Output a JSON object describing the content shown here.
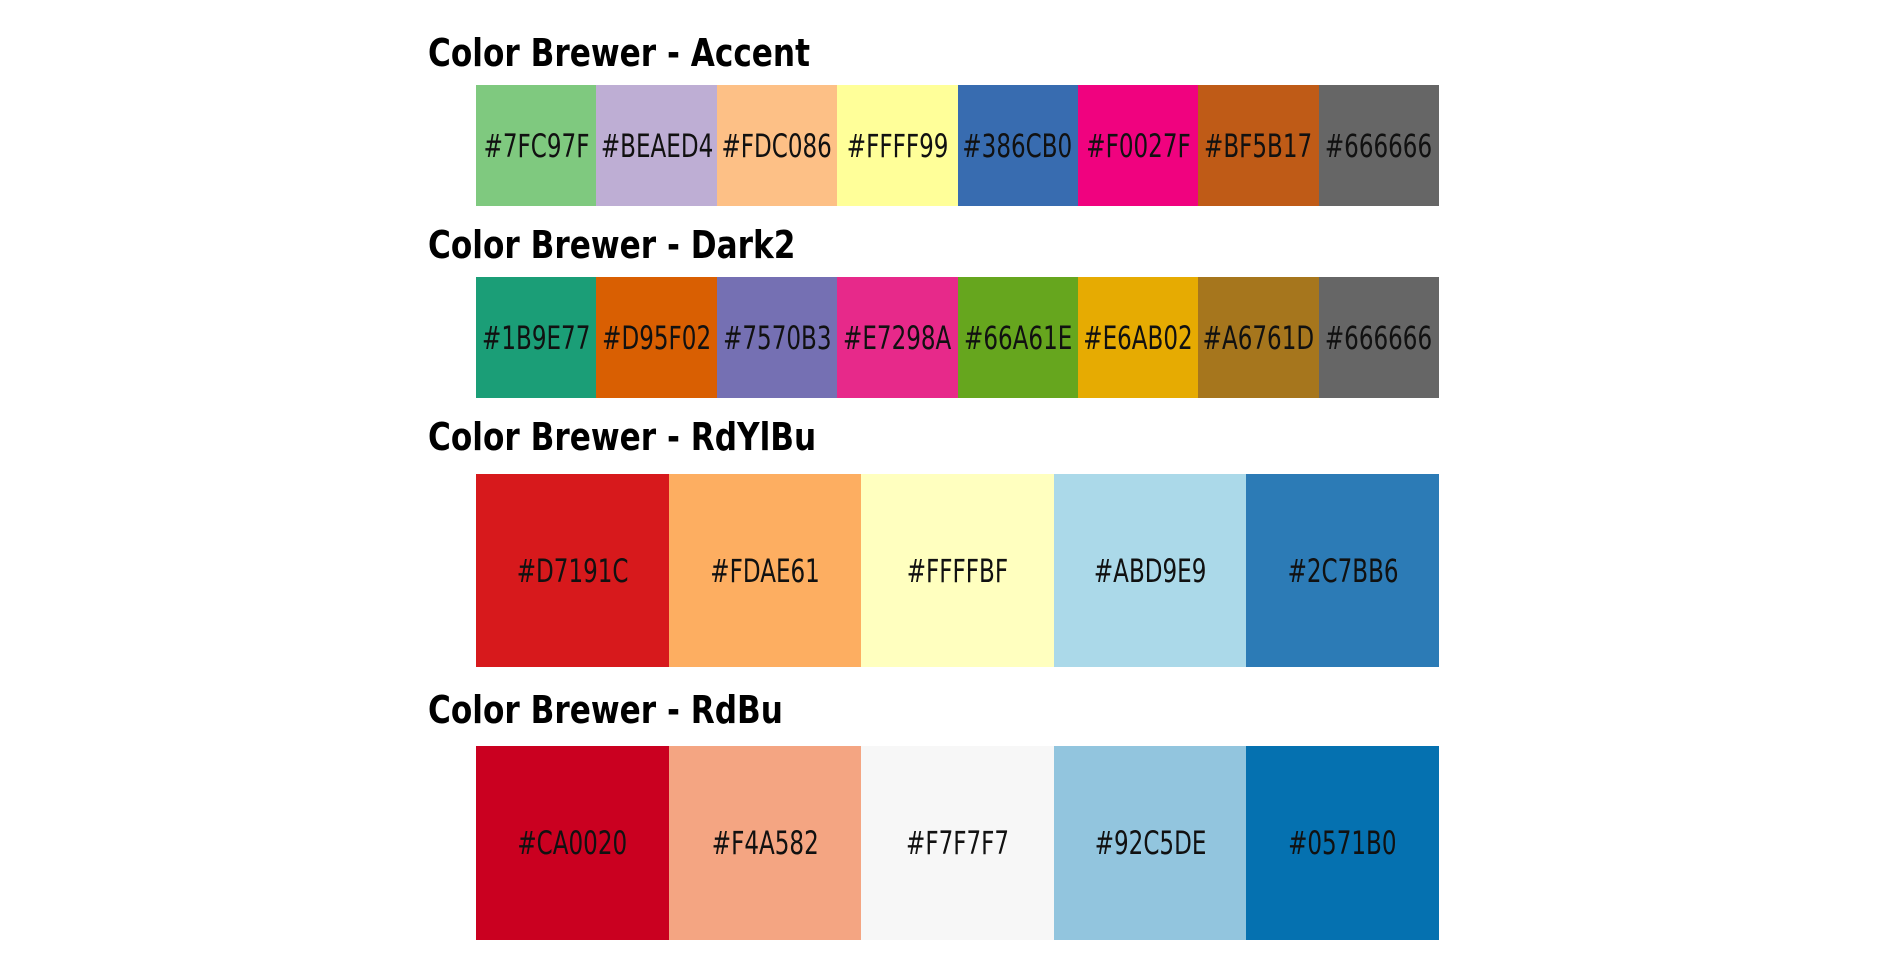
{
  "palettes": [
    {
      "title": "Color Brewer - Accent",
      "colors": [
        "#7FC97F",
        "#BEAED4",
        "#FDC086",
        "#FFFF99",
        "#386CB0",
        "#F0027F",
        "#BF5B17",
        "#666666"
      ]
    },
    {
      "title": "Color Brewer - Dark2",
      "colors": [
        "#1B9E77",
        "#D95F02",
        "#7570B3",
        "#E7298A",
        "#66A61E",
        "#E6AB02",
        "#A6761D",
        "#666666"
      ]
    },
    {
      "title": "Color Brewer - RdYlBu",
      "colors": [
        "#D7191C",
        "#FDAE61",
        "#FFFFBF",
        "#ABD9E9",
        "#2C7BB6"
      ]
    },
    {
      "title": "Color Brewer - RdBu",
      "colors": [
        "#CA0020",
        "#F4A582",
        "#F7F7F7",
        "#92C5DE",
        "#0571B0"
      ]
    }
  ]
}
